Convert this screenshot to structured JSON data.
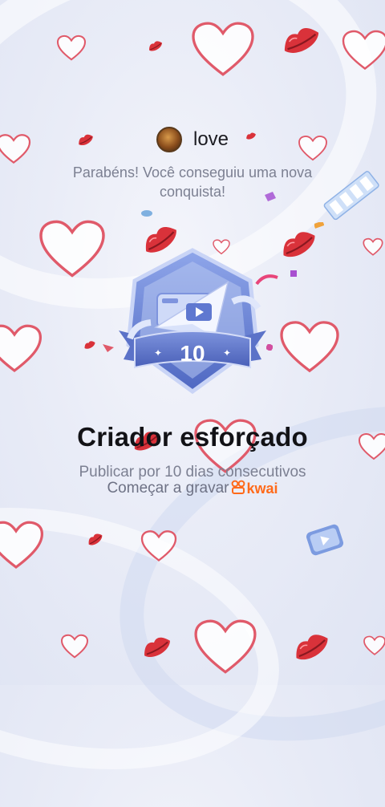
{
  "user": {
    "avatar_icon": "avatar-badge-icon",
    "name": "love"
  },
  "message": "Parabéns! Você conseguiu uma nova conquista!",
  "badge": {
    "number": "10",
    "icon": "paper-plane-video-badge-icon"
  },
  "achievement": {
    "title": "Criador esforçado",
    "description": "Publicar por 10 dias consecutivos",
    "cta_label": "Começar a gravar",
    "brand": "kwai"
  },
  "colors": {
    "accent": "#ff6a1a",
    "badge_blue": "#5b74c9",
    "heart_red": "#d9323a",
    "text_muted": "#7c8092"
  }
}
